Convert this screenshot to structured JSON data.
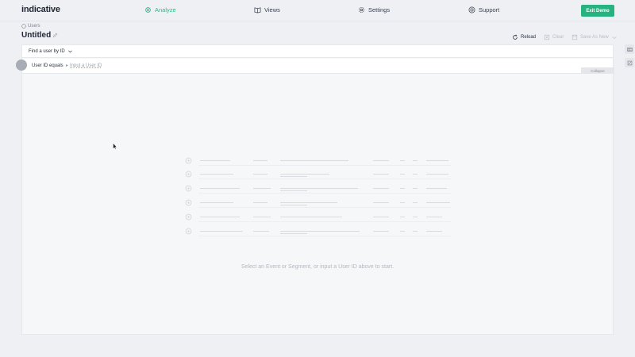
{
  "app": {
    "logo": "indicative"
  },
  "nav": {
    "items": [
      {
        "label": "Analyze",
        "icon": "gear-cog-icon",
        "active": true
      },
      {
        "label": "Views",
        "icon": "book-icon",
        "active": false
      },
      {
        "label": "Settings",
        "icon": "settings-icon",
        "active": false
      },
      {
        "label": "Support",
        "icon": "lifebuoy-icon",
        "active": false
      }
    ],
    "exit_label": "Exit Demo"
  },
  "header": {
    "breadcrumb": "Users",
    "title": "Untitled",
    "actions": {
      "reload": "Reload",
      "clear": "Clear",
      "save_as": "Save As New"
    }
  },
  "finder": {
    "label": "Find a user by ID",
    "filter_label": "User ID equals",
    "filter_placeholder": "Input a User ID",
    "collapse": "Collapse"
  },
  "empty_state": {
    "message": "Select an Event or Segment, or input a User ID above to start."
  },
  "colors": {
    "accent": "#26b380",
    "background": "#eef0f3",
    "panel": "#f6f7f9"
  }
}
